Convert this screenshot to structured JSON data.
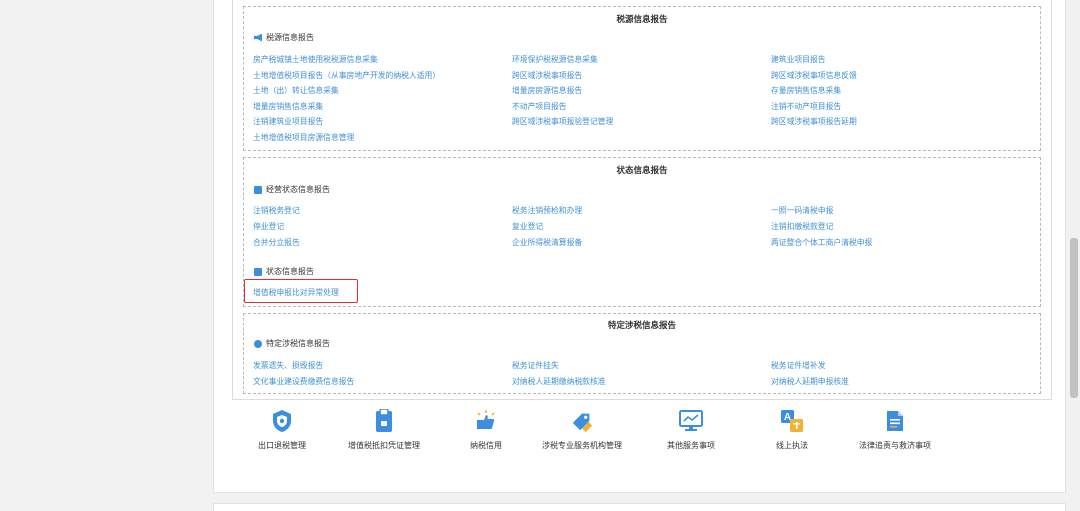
{
  "sections": {
    "tax_source": {
      "title": "税源信息报告",
      "sub_title": "税源信息报告",
      "links": [
        "房产税城镇土地使用税税源信息采集",
        "环境保护税税源信息采集",
        "建筑业项目报告",
        "土地增值税项目报告（从事房地产开发的纳税人适用）",
        "跨区域涉税事项报告",
        "跨区域涉税事项信息反馈",
        "土地（出）转让信息采集",
        "增量房房源信息报告",
        "存量房销售信息采集",
        "增量房销售信息采集",
        "不动产项目报告",
        "注销不动产项目报告",
        "注销建筑业项目报告",
        "跨区域涉税事项报验登记管理",
        "跨区域涉税事项报告延期",
        "土地增值税项目房源信息管理"
      ]
    },
    "status": {
      "title": "状态信息报告",
      "sub_title_1": "经营状态信息报告",
      "links_1": [
        "注销税务登记",
        "税务注销预检和办理",
        "一照一码清税申报",
        "停业登记",
        "复业登记",
        "注销扣缴税款登记",
        "合并分立报告",
        "企业所得税清算报备",
        "两证整合个体工商户清税申报"
      ],
      "sub_title_2": "状态信息报告",
      "highlight_link": "增值税申报比对异常处理"
    },
    "special": {
      "title": "特定涉税信息报告",
      "sub_title": "特定涉税信息报告",
      "links": [
        "发票遗失、损毁报告",
        "税务证件挂失",
        "税务证件增补发",
        "文化事业建设费缴费信息报告",
        "对纳税人延期缴纳税款核准",
        "对纳税人延期申报核准"
      ]
    }
  },
  "services": [
    {
      "label": "出口退税管理",
      "icon": "shield-icon"
    },
    {
      "label": "增值税抵扣凭证管理",
      "icon": "document-lock-icon"
    },
    {
      "label": "纳税信用",
      "icon": "thumbs-up-icon"
    },
    {
      "label": "涉税专业服务机构管理",
      "icon": "tag-icon"
    },
    {
      "label": "其他服务事项",
      "icon": "monitor-icon"
    },
    {
      "label": "线上执法",
      "icon": "translate-icon"
    },
    {
      "label": "法律追责与救济事项",
      "icon": "document-icon"
    }
  ],
  "colors": {
    "link": "#3e8fd9",
    "icon_blue": "#3b8fe0",
    "highlight": "#e0312c"
  }
}
